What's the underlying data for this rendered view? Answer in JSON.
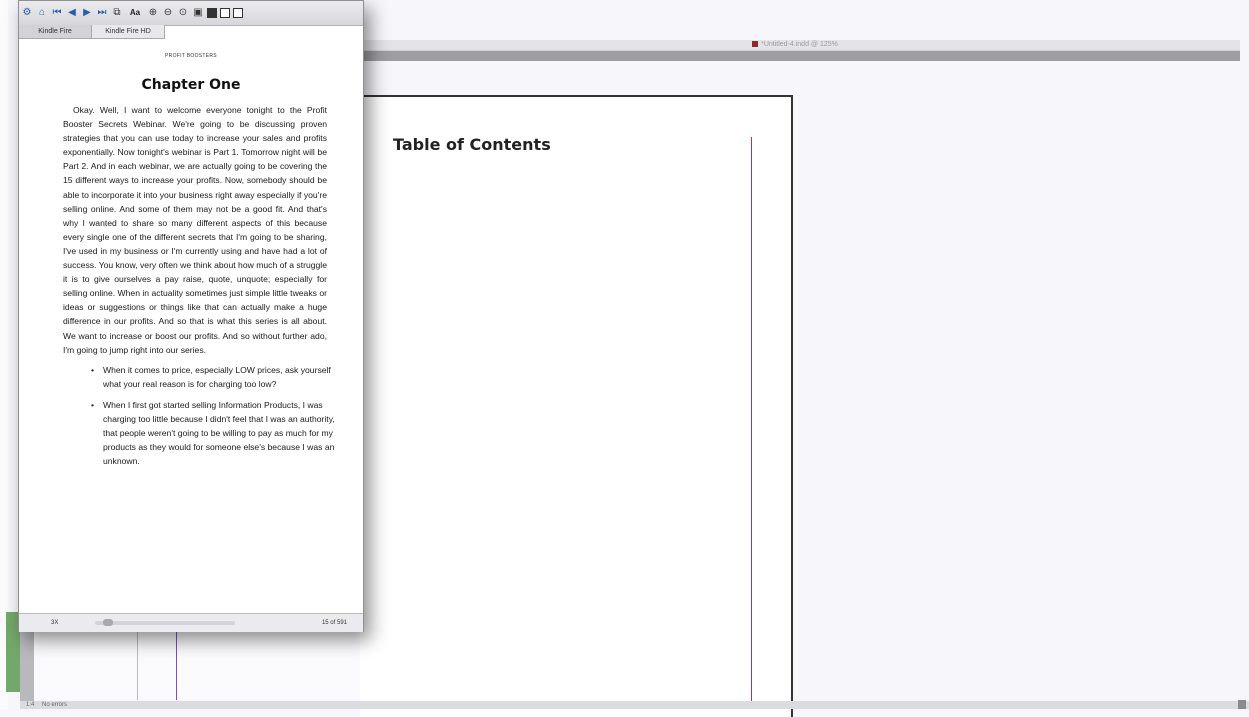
{
  "layout_app": {
    "document_title": "*Untitled-4.indd @ 125%",
    "page_heading": "Table of Contents",
    "status": "1:4",
    "status_extra": "No errors"
  },
  "previewer": {
    "toolbar": {
      "icons": [
        "open-icon",
        "home-icon",
        "first-page-icon",
        "prev-page-icon",
        "next-page-icon",
        "last-page-icon",
        "copy-icon",
        "font-size-icon",
        "zoom-in-icon",
        "zoom-out-icon",
        "zoom-fit-icon",
        "full-screen-icon",
        "device-kindle-icon",
        "device-phone-icon",
        "device-tablet-icon"
      ],
      "font_label": "Aa"
    },
    "tabs": [
      "Kindle Fire",
      "Kindle Fire HD"
    ],
    "running_head": "PROFIT BOOSTERS",
    "chapter_title": "Chapter One",
    "body": "Okay. Well, I want to welcome everyone tonight to the Profit Booster Secrets Webinar. We're going to be discussing proven strategies that you can use today to increase your sales and profits exponentially. Now tonight's webinar is Part 1. Tomorrow night will be Part 2. And in each webinar, we are actually going to be covering the 15 different ways to increase your profits. Now, somebody should be able to incorporate it into your business right away especially if you're selling online. And some of them may not be a good fit. And that's why I wanted to share so many different aspects of this because every single one of the different secrets that I'm going to be sharing, I've used in my business or I'm currently using and have had a lot of success. You know, very often we think about how much of a struggle it is to give ourselves a pay raise, quote, unquote; especially for selling online. When in actuality sometimes just simple little tweaks or ideas or suggestions or things like that can actually make a huge difference in our profits. And so that is what this series is all about. We want to increase or boost our profits. And so without further ado, I'm going to jump right into our series.",
    "bullets": [
      "When it comes to price, especially LOW prices, ask yourself what your real reason is for charging too low?",
      "When I first got started selling Information Products, I was charging too little because I didn't feel that I was an authority, that people weren't going to be willing to pay as much for my products as they would for someone else's because I was an unknown."
    ],
    "footer": {
      "zoom": "3X",
      "page_count": "15 of 591",
      "progress": 0.03
    }
  }
}
